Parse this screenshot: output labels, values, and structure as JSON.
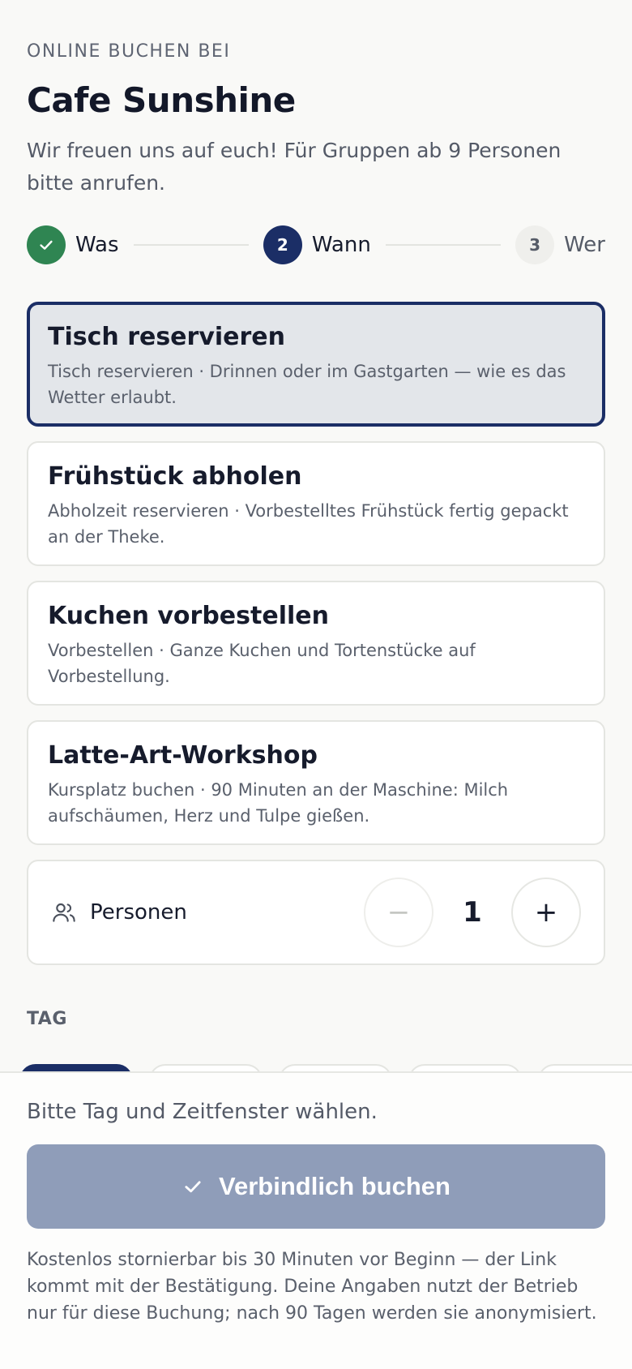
{
  "header": {
    "eyebrow": "ONLINE BUCHEN BEI",
    "title": "Cafe Sunshine",
    "intro": "Wir freuen uns auf euch! Für Gruppen ab 9 Personen bitte anrufen."
  },
  "stepper": {
    "steps": [
      {
        "label": "Was",
        "number": "1",
        "state": "done"
      },
      {
        "label": "Wann",
        "number": "2",
        "state": "active"
      },
      {
        "label": "Wer",
        "number": "3",
        "state": "todo"
      }
    ]
  },
  "options": [
    {
      "title": "Tisch reservieren",
      "desc": "Tisch reservieren · Drinnen oder im Gastgarten — wie es das Wetter erlaubt.",
      "selected": true
    },
    {
      "title": "Frühstück abholen",
      "desc": "Abholzeit reservieren · Vorbestelltes Frühstück fertig gepackt an der Theke.",
      "selected": false
    },
    {
      "title": "Kuchen vorbestellen",
      "desc": "Vorbestellen · Ganze Kuchen und Tortenstücke auf Vorbestellung.",
      "selected": false
    },
    {
      "title": "Latte-Art-Workshop",
      "desc": "Kursplatz buchen · 90 Minuten an der Maschine: Milch aufschäumen, Herz und Tulpe gießen.",
      "selected": false
    }
  ],
  "persons": {
    "label": "Personen",
    "count": "1",
    "minus": "−",
    "plus": "+"
  },
  "day": {
    "section_label": "TAG"
  },
  "footer": {
    "hint": "Bitte Tag und Zeitfenster wählen.",
    "book_label": "Verbindlich buchen",
    "legal": "Kostenlos stornierbar bis 30 Minuten vor Beginn — der Link kommt mit der Bestätigung. Deine Angaben nutzt der Betrieb nur für diese Buchung; nach 90 Tagen werden sie anonymisiert."
  },
  "colors": {
    "accent": "#1b2e66",
    "done": "#2f8552",
    "button_disabled": "#8f9db9"
  },
  "icons": {
    "step_done": "check-icon",
    "persons": "users-icon",
    "book": "check-icon"
  }
}
